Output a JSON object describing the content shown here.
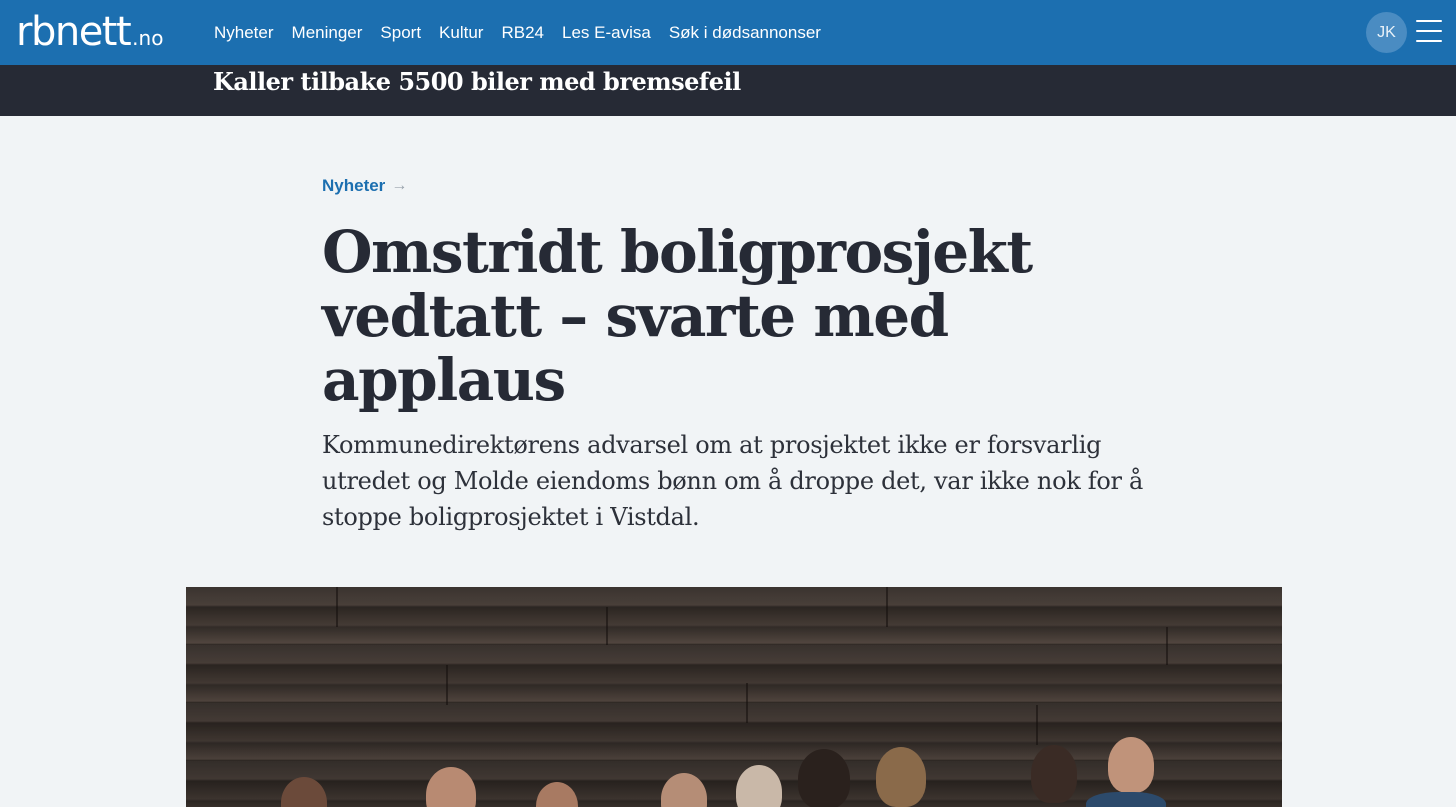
{
  "site": {
    "logo_main": "rbnett",
    "logo_tld": ".no"
  },
  "nav": {
    "items": [
      "Nyheter",
      "Meninger",
      "Sport",
      "Kultur",
      "RB24",
      "Les E-avisa",
      "Søk i dødsannonser"
    ]
  },
  "user": {
    "initials": "JK"
  },
  "breaking": {
    "headline": "Kaller tilbake 5500 biler med bremsefeil"
  },
  "article": {
    "section": "Nyheter",
    "title": "Omstridt boligprosjekt vedtatt – svarte med applaus",
    "lead": "Kommunedirektørens advarsel om at prosjektet ikke er forsvarlig utredet og Molde eiendoms bønn om å droppe det, var ikke nok for å stoppe boligprosjektet i Vistdal."
  },
  "icons": {
    "section_arrow": "arrow-right-icon",
    "menu": "hamburger-menu-icon"
  },
  "colors": {
    "brand_blue": "#1c6fb0",
    "breaking_bar": "#262a35",
    "page_bg": "#f1f4f6",
    "headline_text": "#262a35"
  }
}
